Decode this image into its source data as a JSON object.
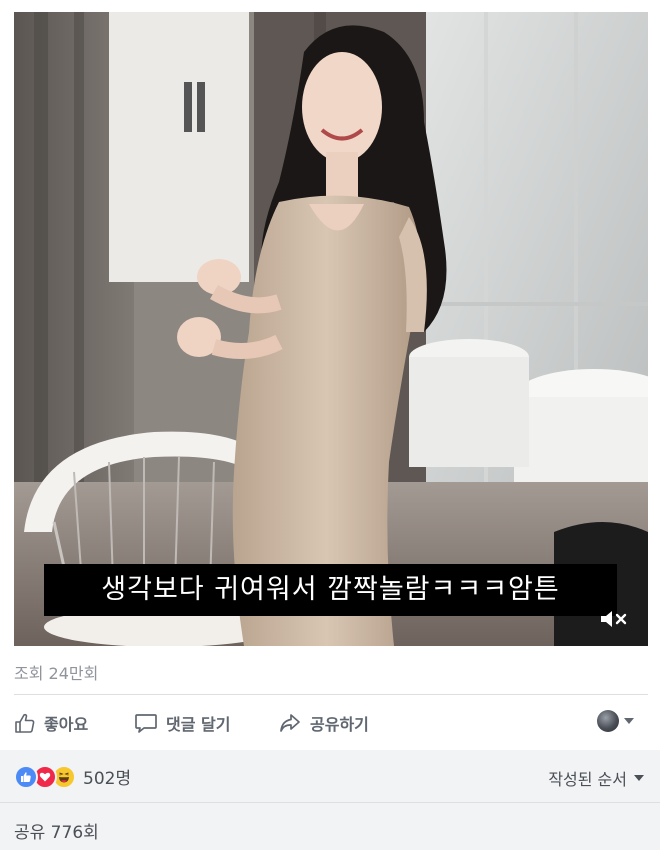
{
  "video": {
    "caption": "생각보다 귀여워서 깜짝놀람ㅋㅋㅋ암튼",
    "mute_icon": "speaker-muted-icon"
  },
  "stats": {
    "views": "조회 24만회"
  },
  "actions": {
    "like_label": "좋아요",
    "comment_label": "댓글 달기",
    "share_label": "공유하기"
  },
  "reactions": {
    "icons": [
      "like-icon",
      "love-icon",
      "haha-icon"
    ],
    "count": "502명",
    "sort_label": "작성된 순서",
    "shares": "공유 776회"
  },
  "colors": {
    "like": "#4c8bf5",
    "love": "#f0284a",
    "haha": "#f7c72e",
    "footer_bg": "#f2f3f5",
    "muted_text": "#90949c"
  }
}
